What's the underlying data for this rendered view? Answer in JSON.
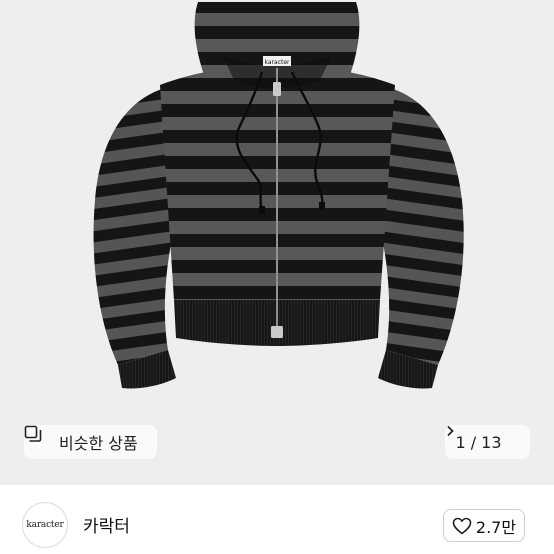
{
  "product_image": {
    "alt": "striped zip-up hoodie",
    "tag_text": "karacter"
  },
  "similar_products": {
    "label": "비슷한 상품",
    "icon": "similar-items-icon"
  },
  "pager": {
    "current": "1",
    "separator": "/",
    "total": "13",
    "text": "1 / 13",
    "icon": "chevron-right-icon"
  },
  "shop": {
    "logo_text": "karacter",
    "name": "카락터"
  },
  "like": {
    "count": "2.7만",
    "icon": "heart-outline-icon"
  },
  "colors": {
    "background": "#eeeeee",
    "stripe_dark": "#141414",
    "stripe_gray": "#5a5a5a"
  }
}
